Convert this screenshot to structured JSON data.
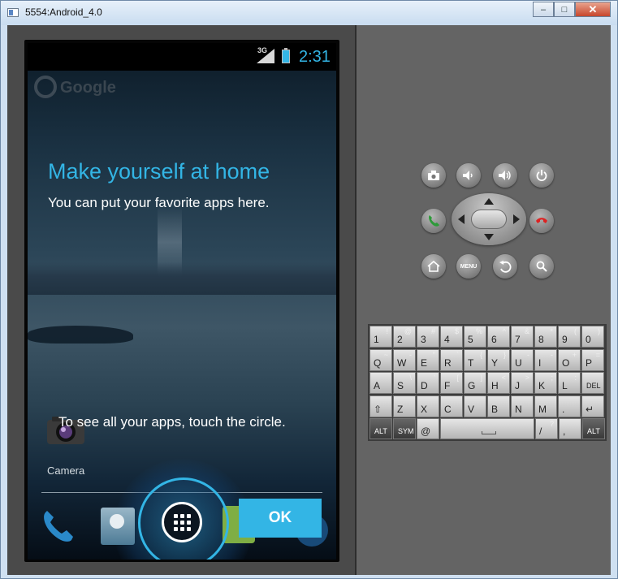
{
  "window": {
    "title": "5554:Android_4.0",
    "minimize": "–",
    "maximize": "□",
    "close": "✕"
  },
  "status": {
    "network": "3G",
    "time": "2:31"
  },
  "home": {
    "search_label": "Google",
    "overlay_title": "Make yourself at home",
    "overlay_subtitle": "You can put your favorite apps here.",
    "hint": "To see all your apps, touch the circle.",
    "camera_label": "Camera",
    "ok_label": "OK"
  },
  "controls": {
    "camera": "camera-icon",
    "volume_down": "volume-down-icon",
    "volume_up": "volume-up-icon",
    "power": "power-icon",
    "call": "call-icon",
    "end_call": "end-call-icon",
    "home": "home-icon",
    "menu": "MENU",
    "back": "back-icon",
    "search": "search-icon"
  },
  "keyboard": {
    "row1": [
      {
        "m": "1",
        "s": "!"
      },
      {
        "m": "2",
        "s": "@"
      },
      {
        "m": "3",
        "s": "#"
      },
      {
        "m": "4",
        "s": "$"
      },
      {
        "m": "5",
        "s": "%"
      },
      {
        "m": "6",
        "s": "^"
      },
      {
        "m": "7",
        "s": "&"
      },
      {
        "m": "8",
        "s": "*"
      },
      {
        "m": "9",
        "s": "("
      },
      {
        "m": "0",
        "s": ")"
      }
    ],
    "row2": [
      {
        "m": "Q",
        "s": "~"
      },
      {
        "m": "W",
        "s": "-"
      },
      {
        "m": "E",
        "s": "\""
      },
      {
        "m": "R",
        "s": "`"
      },
      {
        "m": "T",
        "s": "{"
      },
      {
        "m": "Y",
        "s": "}"
      },
      {
        "m": "U",
        "s": "-"
      },
      {
        "m": "I",
        "s": "-"
      },
      {
        "m": "O",
        "s": "+"
      },
      {
        "m": "P",
        "s": "="
      }
    ],
    "row3": [
      {
        "m": "A",
        "s": ""
      },
      {
        "m": "S",
        "s": "\\"
      },
      {
        "m": "D",
        "s": "'"
      },
      {
        "m": "F",
        "s": "["
      },
      {
        "m": "G",
        "s": "]"
      },
      {
        "m": "H",
        "s": "<"
      },
      {
        "m": "J",
        "s": ">"
      },
      {
        "m": "K",
        "s": ";"
      },
      {
        "m": "L",
        "s": ":"
      },
      {
        "m": "DEL",
        "s": ""
      }
    ],
    "row4": [
      {
        "m": "⇧",
        "s": ""
      },
      {
        "m": "Z",
        "s": ""
      },
      {
        "m": "X",
        "s": ""
      },
      {
        "m": "C",
        "s": ""
      },
      {
        "m": "V",
        "s": ""
      },
      {
        "m": "B",
        "s": ""
      },
      {
        "m": "N",
        "s": ""
      },
      {
        "m": "M",
        "s": ""
      },
      {
        "m": ".",
        "s": ""
      },
      {
        "m": "↵",
        "s": ""
      }
    ],
    "alt": "ALT",
    "sym": "SYM",
    "at": "@",
    "slash": "/",
    "question": "?",
    "comma": ","
  }
}
